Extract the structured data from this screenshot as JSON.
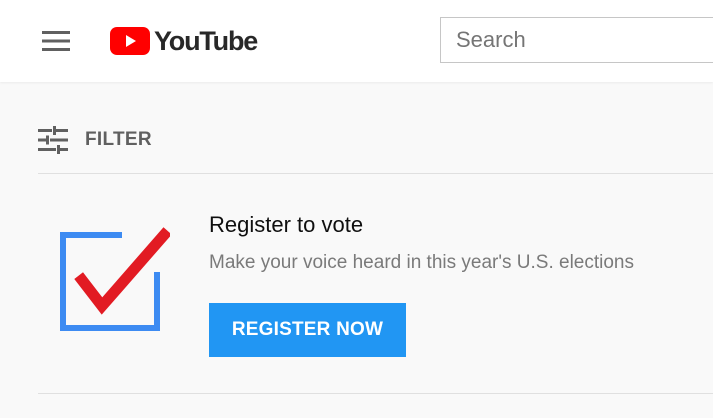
{
  "header": {
    "menu_icon": "hamburger-menu-icon",
    "logo_text": "YouTube",
    "logo_icon": "youtube-play-icon",
    "search_placeholder": "Search",
    "search_value": ""
  },
  "filter": {
    "icon": "tune-sliders-icon",
    "label": "FILTER"
  },
  "promo": {
    "icon": "ballot-checkmark-icon",
    "title": "Register to vote",
    "subtitle": "Make your voice heard in this year's U.S. elections",
    "button_label": "REGISTER NOW"
  },
  "colors": {
    "brand_red": "#ff0000",
    "button_blue": "#2196f3",
    "checkbox_blue": "#3d8bf2",
    "check_red": "#e21b23"
  }
}
